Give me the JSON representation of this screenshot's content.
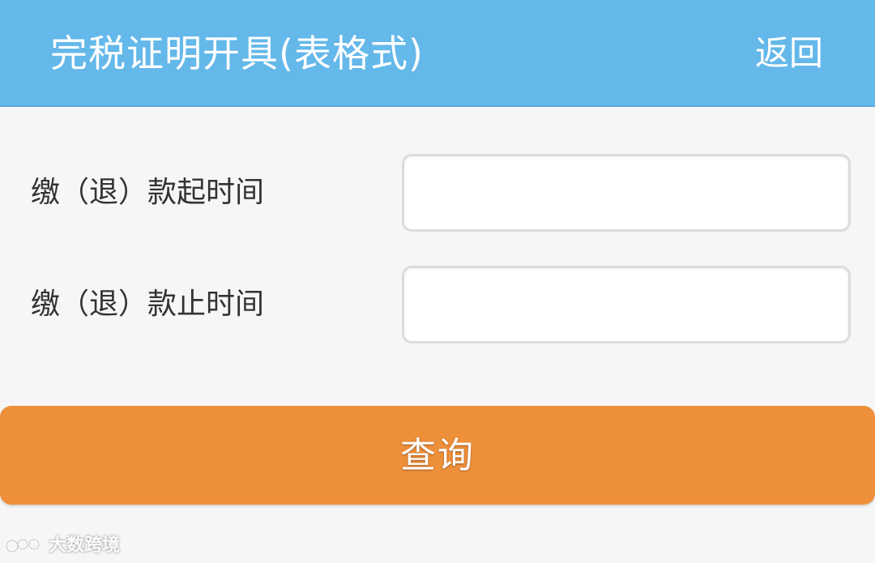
{
  "header": {
    "title": "完税证明开具(表格式)",
    "back_label": "返回",
    "background_color": "#64b8ea"
  },
  "form": {
    "start_label": "缴（退）款起时间",
    "start_value": "",
    "end_label": "缴（退）款止时间",
    "end_value": ""
  },
  "actions": {
    "query_label": "查询",
    "query_color": "#ee8f3a"
  },
  "watermark": {
    "text": "大数跨境",
    "icon": "watermark-logo-icon"
  }
}
